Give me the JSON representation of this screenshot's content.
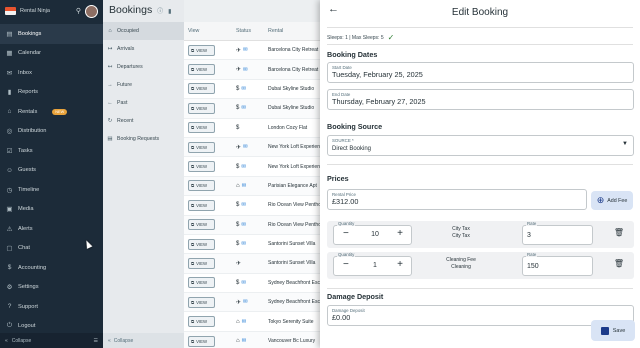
{
  "app": {
    "brand": "Rental Ninja"
  },
  "nav": {
    "items": [
      {
        "label": "Bookings",
        "icon": "bookings-icon",
        "glyph": "▤",
        "active": true
      },
      {
        "label": "Calendar",
        "icon": "calendar-icon",
        "glyph": "▦"
      },
      {
        "label": "Inbox",
        "icon": "inbox-icon",
        "glyph": "✉"
      },
      {
        "label": "Reports",
        "icon": "reports-icon",
        "glyph": "▮"
      },
      {
        "label": "Rentals",
        "icon": "rentals-icon",
        "glyph": "⌂",
        "badge": "NEW"
      },
      {
        "label": "Distribution",
        "icon": "distribution-icon",
        "glyph": "◎"
      },
      {
        "label": "Tasks",
        "icon": "tasks-icon",
        "glyph": "☑"
      },
      {
        "label": "Guests",
        "icon": "guests-icon",
        "glyph": "☺"
      },
      {
        "label": "Timeline",
        "icon": "timeline-icon",
        "glyph": "◷"
      },
      {
        "label": "Media",
        "icon": "media-icon",
        "glyph": "▣"
      },
      {
        "label": "Alerts",
        "icon": "alerts-icon",
        "glyph": "⚠"
      },
      {
        "label": "Chat",
        "icon": "chat-icon",
        "glyph": "▢"
      },
      {
        "label": "Accounting",
        "icon": "accounting-icon",
        "glyph": "$"
      },
      {
        "label": "Settings",
        "icon": "settings-icon",
        "glyph": "⚙"
      },
      {
        "label": "Support",
        "icon": "support-icon",
        "glyph": "?"
      },
      {
        "label": "Logout",
        "icon": "logout-icon",
        "glyph": "⏻"
      }
    ],
    "collapse_label": "Collapse"
  },
  "bookings": {
    "title": "Bookings",
    "subnav": [
      {
        "label": "Occupied",
        "icon": "occupied-icon",
        "glyph": "⌂",
        "active": true
      },
      {
        "label": "Arrivals",
        "icon": "arrivals-icon",
        "glyph": "↦"
      },
      {
        "label": "Departures",
        "icon": "departures-icon",
        "glyph": "↤"
      },
      {
        "label": "Future",
        "icon": "future-icon",
        "glyph": "→"
      },
      {
        "label": "Past",
        "icon": "past-icon",
        "glyph": "←"
      },
      {
        "label": "Recent",
        "icon": "recent-icon",
        "glyph": "↻"
      },
      {
        "label": "Booking Requests",
        "icon": "booking-requests-icon",
        "glyph": "▤"
      }
    ],
    "collapse_label": "Collapse"
  },
  "table": {
    "headers": {
      "view": "View",
      "status": "Status",
      "rental": "Rental"
    },
    "view_label": "VIEW",
    "rows": [
      {
        "status": "✈",
        "mail": true,
        "rental": "Barcelona City Retreat"
      },
      {
        "status": "✈",
        "mail": true,
        "rental": "Barcelona City Retreat"
      },
      {
        "status": "$",
        "mail": true,
        "rental": "Dubai Skyline Studio"
      },
      {
        "status": "$",
        "mail": true,
        "rental": "Dubai Skyline Studio"
      },
      {
        "status": "$",
        "mail": false,
        "rental": "London Cozy Flat"
      },
      {
        "status": "✈",
        "mail": true,
        "rental": "New York Loft Experience"
      },
      {
        "status": "$",
        "mail": true,
        "rental": "New York Loft Experience"
      },
      {
        "status": "⌂",
        "mail": true,
        "rental": "Parisian Elegance Apt"
      },
      {
        "status": "$",
        "mail": true,
        "rental": "Rio Ocean View Penthouse"
      },
      {
        "status": "$",
        "mail": true,
        "rental": "Rio Ocean View Penthouse"
      },
      {
        "status": "$",
        "mail": true,
        "rental": "Santorini Sunset Villa"
      },
      {
        "status": "✈",
        "mail": false,
        "rental": "Santorini Sunset Villa"
      },
      {
        "status": "$",
        "mail": true,
        "rental": "Sydney Beachfront Escape"
      },
      {
        "status": "✈",
        "mail": true,
        "rental": "Sydney Beachfront Escape"
      },
      {
        "status": "⌂",
        "mail": true,
        "rental": "Tokyo Serenity Suite"
      },
      {
        "status": "⌂",
        "mail": true,
        "rental": "Vancouver Bc Luxury"
      }
    ]
  },
  "drawer": {
    "title": "Edit Booking",
    "sleeps": "Sleeps: 1 | Max Sleeps: 5",
    "dates_section": "Booking Dates",
    "start_label": "Start Date",
    "start_value": "Tuesday, February 25, 2025",
    "end_label": "End Date",
    "end_value": "Thursday, February 27, 2025",
    "source_section": "Booking Source",
    "source_label": "SOURCE *",
    "source_value": "Direct Booking",
    "prices_section": "Prices",
    "rental_price_label": "Rental Price",
    "rental_price_value": "£312.00",
    "add_fee_label": "Add Fee",
    "fees": [
      {
        "quantity_label": "Quantity",
        "quantity": "10",
        "name": "City Tax",
        "subname": "City Tax",
        "rate_label": "Rate",
        "rate": "3"
      },
      {
        "quantity_label": "Quantity",
        "quantity": "1",
        "name": "Cleaning Fee",
        "subname": "Cleaning",
        "rate_label": "Rate",
        "rate": "150"
      }
    ],
    "deposit_section": "Damage Deposit",
    "deposit_label": "Damage Deposit",
    "deposit_value": "£0.00",
    "save_label": "Save"
  }
}
